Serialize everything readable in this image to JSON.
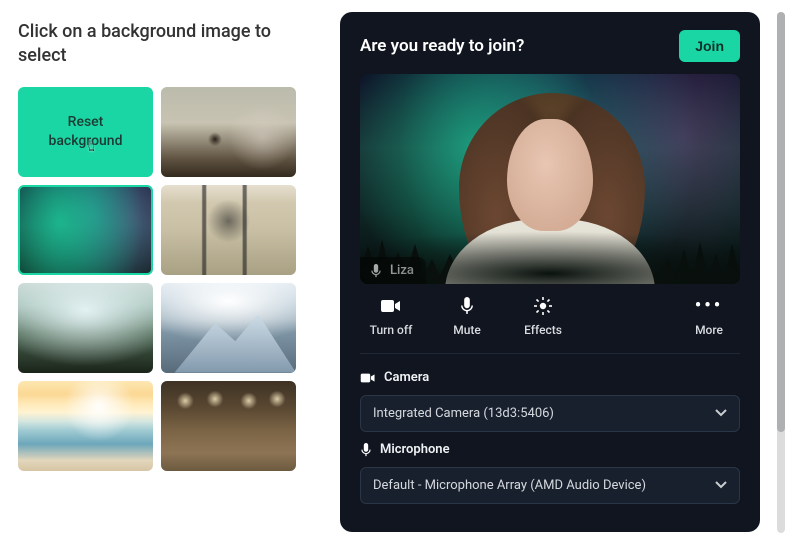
{
  "left": {
    "title": "Click on a background image to select",
    "reset_label": "Reset\nbackground",
    "tiles": [
      {
        "name": "reset",
        "kind": "reset"
      },
      {
        "name": "coffee-shop",
        "kind": "t-cafe"
      },
      {
        "name": "aurora",
        "kind": "t-aurora",
        "selected": true
      },
      {
        "name": "outdoor-chairs",
        "kind": "t-chair"
      },
      {
        "name": "mountain-valley",
        "kind": "t-valley"
      },
      {
        "name": "snow-mountain",
        "kind": "t-mountain"
      },
      {
        "name": "beach-sunset",
        "kind": "t-beach"
      },
      {
        "name": "restaurant",
        "kind": "t-resto"
      }
    ]
  },
  "panel": {
    "title": "Are you ready to join?",
    "join_label": "Join",
    "user_name": "Liza",
    "controls": {
      "turnoff": "Turn off",
      "mute": "Mute",
      "effects": "Effects",
      "more": "More"
    },
    "devices": {
      "camera_label": "Camera",
      "camera_value": "Integrated Camera (13d3:5406)",
      "mic_label": "Microphone",
      "mic_value": "Default - Microphone Array (AMD Audio Device)"
    }
  }
}
